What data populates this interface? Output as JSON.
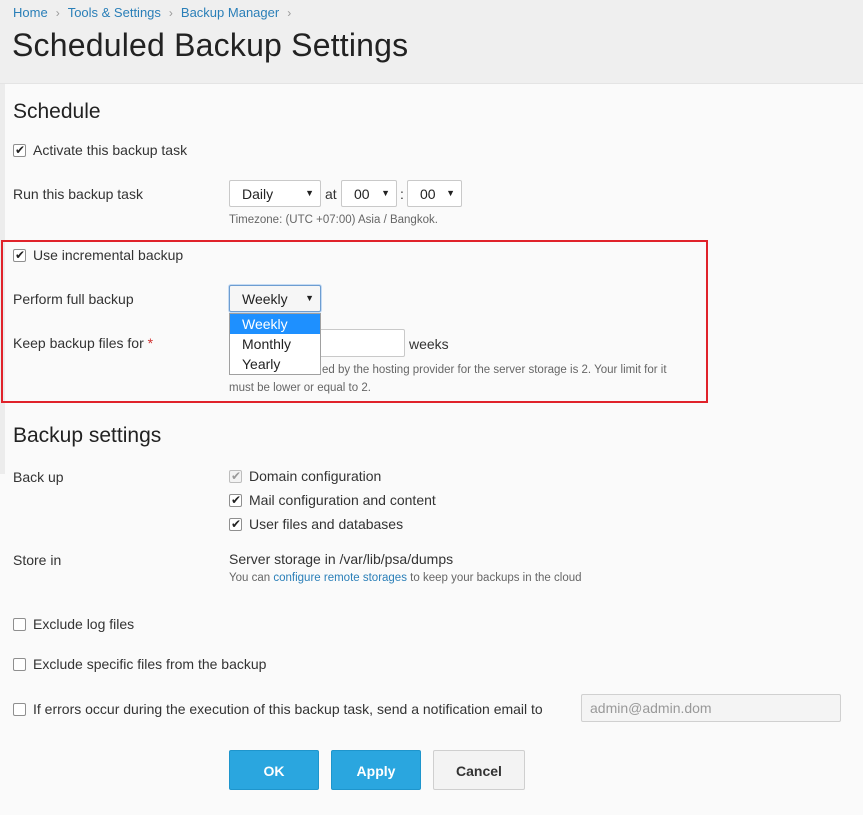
{
  "breadcrumb": [
    {
      "label": "Home"
    },
    {
      "label": "Tools & Settings"
    },
    {
      "label": "Backup Manager"
    }
  ],
  "breadcrumb_separator": "›",
  "page_title": "Scheduled Backup Settings",
  "schedule": {
    "heading": "Schedule",
    "activate_label": "Activate this backup task",
    "activate_checked": true,
    "run_label": "Run this backup task",
    "frequency_value": "Daily",
    "at_label": "at",
    "hour_value": "00",
    "time_sep": ":",
    "minute_value": "00",
    "timezone_hint": "Timezone: (UTC +07:00) Asia / Bangkok.",
    "incremental_label": "Use incremental backup",
    "incremental_checked": true,
    "full_backup_label": "Perform full backup",
    "full_backup_value": "Weekly",
    "full_backup_options": [
      "Weekly",
      "Monthly",
      "Yearly"
    ],
    "keep_label": "Keep backup files for",
    "required_mark": "*",
    "keep_unit": "weeks",
    "limit_hint_line1": "ed by the hosting provider for the server storage is 2. Your limit for it",
    "limit_hint_line2": "must be lower or equal to 2."
  },
  "backup_settings": {
    "heading": "Backup settings",
    "backup_label": "Back up",
    "items": [
      {
        "label": "Domain configuration",
        "checked": true,
        "disabled": true
      },
      {
        "label": "Mail configuration and content",
        "checked": true,
        "disabled": false
      },
      {
        "label": "User files and databases",
        "checked": true,
        "disabled": false
      }
    ],
    "store_label": "Store in",
    "store_value": "Server storage in /var/lib/psa/dumps",
    "remote_hint_prefix": "You can",
    "remote_hint_link": "configure remote storages",
    "remote_hint_suffix": "to keep your backups in the cloud",
    "exclude_log_label": "Exclude log files",
    "exclude_specific_label": "Exclude specific files from the backup",
    "notify_label": "If errors occur during the execution of this backup task, send a notification email to",
    "email_placeholder": "admin@admin.dom"
  },
  "buttons": {
    "ok": "OK",
    "apply": "Apply",
    "cancel": "Cancel"
  },
  "colors": {
    "accent": "#2aa6df",
    "link": "#2a7fb8",
    "highlight_border": "#e0222a",
    "dropdown_selected": "#1e90ff"
  }
}
